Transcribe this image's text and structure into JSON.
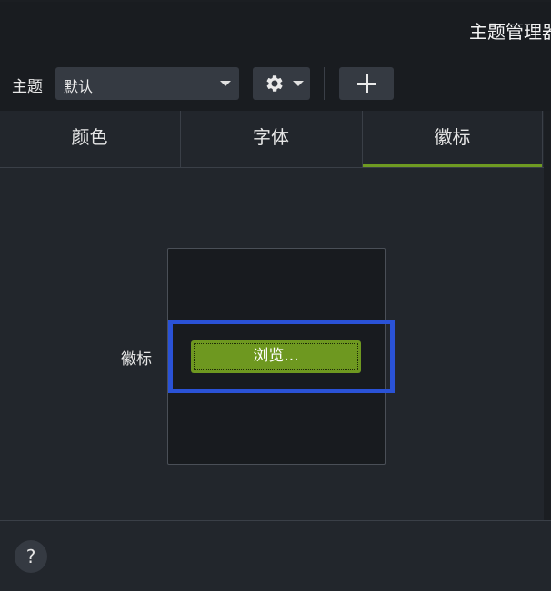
{
  "window": {
    "title": "主题管理器"
  },
  "toolbar": {
    "theme_label": "主题",
    "theme_select_value": "默认",
    "settings_icon": "gear-icon",
    "add_icon": "plus-icon"
  },
  "tabs": [
    {
      "label": "颜色",
      "active": false
    },
    {
      "label": "字体",
      "active": false
    },
    {
      "label": "徽标",
      "active": true
    }
  ],
  "logo_panel": {
    "label": "徽标",
    "browse_label": "浏览..."
  },
  "footer": {
    "help_label": "?"
  },
  "colors": {
    "accent": "#6f9a22",
    "highlight": "#2a52d6",
    "background": "#22262c",
    "toolbar_bg": "#191c20"
  }
}
